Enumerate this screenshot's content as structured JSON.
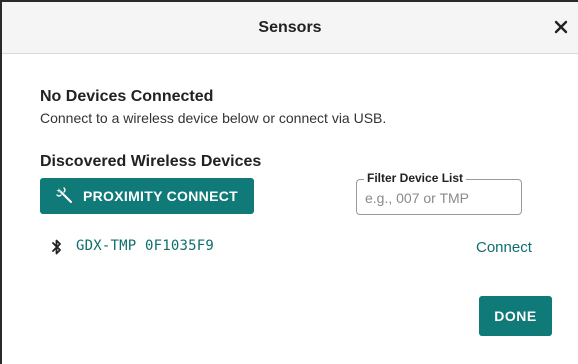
{
  "dialog": {
    "title": "Sensors",
    "close_icon": "close-icon"
  },
  "status": {
    "heading": "No Devices Connected",
    "message": "Connect to a wireless device below or connect via USB."
  },
  "discovered": {
    "heading": "Discovered Wireless Devices",
    "proximity_button": {
      "label": "PROXIMITY CONNECT",
      "icon": "proximity-wand-icon"
    },
    "filter": {
      "label": "Filter Device List",
      "placeholder": "e.g., 007 or TMP",
      "value": ""
    },
    "devices": [
      {
        "icon": "bluetooth-icon",
        "name": "GDX-TMP 0F1035F9",
        "action_label": "Connect"
      }
    ]
  },
  "footer": {
    "done_label": "DONE"
  },
  "colors": {
    "accent": "#0f7a78",
    "link": "#0f6e6c",
    "titlebar_bg": "#f5f5f5"
  }
}
